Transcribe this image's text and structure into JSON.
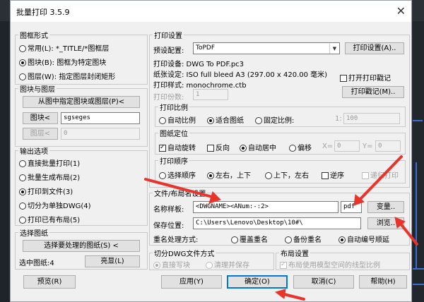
{
  "window": {
    "title": "批量打印 3.5.9",
    "close": "✕"
  },
  "left": {
    "graphic_form": {
      "legend": "图框形式",
      "options": [
        {
          "label": "常用(L): *_TITLE/*图框层",
          "selected": false
        },
        {
          "label": "图块(B): 图框为特定图块",
          "selected": true
        },
        {
          "label": "图层(W): 指定图层封闭矩形",
          "selected": false
        }
      ]
    },
    "block_layer": {
      "legend": "图块与图层",
      "pick_button": "从图中指定图块或图层(P)<",
      "block_button": "图块<",
      "block_value": "sgseges",
      "layer_button": "图层<",
      "layer_value": "0"
    },
    "output": {
      "legend": "输出选项",
      "options": [
        {
          "label": "直接批量打印(1)",
          "selected": false
        },
        {
          "label": "批量生成布局(2)",
          "selected": false
        },
        {
          "label": "打印到文件(3)",
          "selected": true
        },
        {
          "label": "切分为单独DWG(4)",
          "selected": false
        },
        {
          "label": "打印已有布局(5)",
          "selected": false
        }
      ]
    },
    "select": {
      "legend": "选择图纸",
      "select_button": "选择要处理的图纸(S) <",
      "count_label": "选中图纸:4",
      "highlight_button": "亮显(L)"
    }
  },
  "print": {
    "legend": "打印设置",
    "preset_label": "预设配置:",
    "preset_value": "ToPDF",
    "settings_button": "打印设置(A)..",
    "device": "打印设备: DWG To PDF.pc3",
    "paper": "纸张设定: ISO full bleed A3 (297.00 x 420.00 毫米)",
    "style": "打印样式: monochrome.ctb",
    "open_stamp_label": "打开打印戳记",
    "open_stamp_checked": false,
    "stamp_button": "打印戳记(M)..",
    "copies_label": "打印份数:",
    "copies_value": "1",
    "scale": {
      "legend": "打印比例",
      "options": [
        {
          "label": "自动比例",
          "selected": false
        },
        {
          "label": "适合图纸",
          "selected": true
        },
        {
          "label": "固定比例:",
          "selected": false
        }
      ],
      "ratio_label": "1:",
      "ratio_value": "100"
    },
    "position": {
      "legend": "图纸定位",
      "auto_rotate": "自动旋转",
      "auto_rotate_checked": true,
      "reverse": "反向",
      "reverse_checked": false,
      "center": "自动居中",
      "center_selected": true,
      "offset": "偏移",
      "offset_selected": false,
      "x_label": "X=",
      "x_value": "0",
      "y_label": "Y=",
      "y_value": "0"
    },
    "order": {
      "legend": "打印顺序",
      "options": [
        {
          "label": "选择顺序",
          "selected": false
        },
        {
          "label": "左右，上下",
          "selected": true
        },
        {
          "label": "上下，左右",
          "selected": false
        }
      ],
      "reverse": "逆序",
      "reverse_checked": false,
      "recursive": "递归打印",
      "recursive_checked": false
    }
  },
  "file": {
    "legend": "文件/布局名设置",
    "name_label": "名称样板:",
    "name_value": "<DWGNAME><ANum:-:2>",
    "ext_value": "pdf",
    "var_button": "变量..",
    "save_label": "保存位置:",
    "save_value": "C:\\Users\\Lenovo\\Desktop\\10#\\",
    "browse_button": "浏览..",
    "dup_label": "重名处理方式:",
    "dup_options": [
      {
        "label": "覆盖重名",
        "selected": false
      },
      {
        "label": "备份重名",
        "selected": false
      },
      {
        "label": "自动编号顺延",
        "selected": true
      }
    ]
  },
  "split": {
    "legend": "切分DWG文件方式",
    "options": [
      {
        "label": "直接写块",
        "selected": true
      },
      {
        "label": "清理并保存",
        "selected": false
      }
    ]
  },
  "layout": {
    "legend": "布局设置",
    "label": "布局使用模型空间的线型比例",
    "checked": true
  },
  "footer": {
    "preview": "预览(R)",
    "apply": "应用(Y)",
    "ok": "确定(O)",
    "cancel": "取消(C)",
    "help": "帮助(H)"
  },
  "annotation_color": "#e8342a"
}
